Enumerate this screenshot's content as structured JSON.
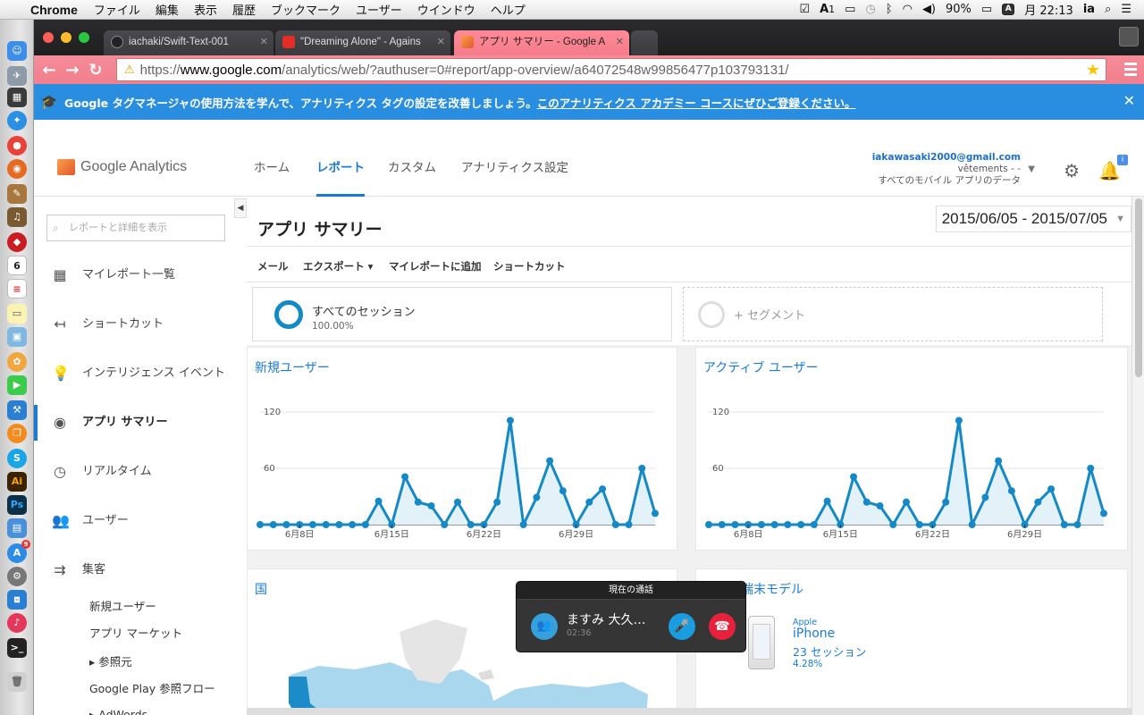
{
  "menubar": {
    "app": "Chrome",
    "items": [
      "ファイル",
      "編集",
      "表示",
      "履歴",
      "ブックマーク",
      "ユーザー",
      "ウインドウ",
      "ヘルプ"
    ],
    "badge_a1": "1",
    "battery": "90%",
    "clock": "月 22:13",
    "user": "ia",
    "a_box": "A"
  },
  "dock": {
    "calendar_day": "6",
    "badge_count": "9"
  },
  "browser": {
    "tabs": [
      {
        "title": "iachaki/Swift-Text-001"
      },
      {
        "title": "\"Dreaming Alone\" - Agains"
      },
      {
        "title": "アプリ サマリー - Google A"
      }
    ],
    "url_prefix": "https://",
    "url_host": "www.google.com",
    "url_path": "/analytics/web/?authuser=0#report/app-overview/a64072548w99856477p103793131/"
  },
  "notice": {
    "text": "Google タグマネージャの使用方法を学んで、アナリティクス タグの設定を改善しましょう。",
    "link": "このアナリティクス アカデミー コースにぜひご登録ください。"
  },
  "header": {
    "logo": "Google Analytics",
    "tabs": [
      "ホーム",
      "レポート",
      "カスタム",
      "アナリティクス設定"
    ],
    "email": "iakawasaki2000@gmail.com",
    "property": "vêtements - -",
    "view": "すべてのモバイル アプリのデータ",
    "bell_badge": "i"
  },
  "leftnav": {
    "search_placeholder": "レポートと詳細を表示",
    "items": [
      "マイレポート一覧",
      "ショートカット",
      "インテリジェンス イベント",
      "アプリ サマリー",
      "リアルタイム",
      "ユーザー",
      "集客"
    ],
    "sub_items": [
      "新規ユーザー",
      "アプリ マーケット",
      "▸ 参照元",
      "Google Play 参照フロー",
      "▸ AdWords"
    ]
  },
  "main": {
    "title": "アプリ サマリー",
    "date_range": "2015/06/05 - 2015/07/05",
    "actions": [
      "メール",
      "エクスポート ▾",
      "マイレポートに追加",
      "ショートカット"
    ],
    "segment_name": "すべてのセッション",
    "segment_pct": "100.00%",
    "add_segment": "+ セグメント",
    "country_title": "国",
    "device_title": "上位の端末モデル",
    "device": {
      "brand": "Apple",
      "model": "iPhone",
      "sessions": "23 セッション",
      "pct": "4.28%"
    }
  },
  "call": {
    "header": "現在の通話",
    "name": "ますみ 大久…",
    "time": "02:36"
  },
  "colors": {
    "accent": "#1a7bd6",
    "chart_line": "#1589c6",
    "chart_fill": "#e3f1f9",
    "tab_active": "#f58c99",
    "notice": "#2a8ee0"
  },
  "chart_data": [
    {
      "type": "area",
      "title": "新規ユーザー",
      "ylim": [
        0,
        120
      ],
      "yticks": [
        "120",
        "60"
      ],
      "xtick_labels": [
        "6月8日",
        "6月15日",
        "6月22日",
        "6月29日"
      ],
      "x": [
        "6/5",
        "6/6",
        "6/7",
        "6/8",
        "6/9",
        "6/10",
        "6/11",
        "6/12",
        "6/13",
        "6/14",
        "6/15",
        "6/16",
        "6/17",
        "6/18",
        "6/19",
        "6/20",
        "6/21",
        "6/22",
        "6/23",
        "6/24",
        "6/25",
        "6/26",
        "6/27",
        "6/28",
        "6/29",
        "6/30",
        "7/1",
        "7/2",
        "7/3",
        "7/4",
        "7/5"
      ],
      "values": [
        0,
        0,
        0,
        0,
        0,
        0,
        0,
        0,
        0,
        25,
        0,
        51,
        24,
        20,
        0,
        24,
        0,
        0,
        24,
        111,
        0,
        29,
        68,
        36,
        0,
        24,
        38,
        0,
        0,
        60,
        12
      ]
    },
    {
      "type": "area",
      "title": "アクティブ ユーザー",
      "ylim": [
        0,
        120
      ],
      "yticks": [
        "120",
        "60"
      ],
      "xtick_labels": [
        "6月8日",
        "6月15日",
        "6月22日",
        "6月29日"
      ],
      "x": [
        "6/5",
        "6/6",
        "6/7",
        "6/8",
        "6/9",
        "6/10",
        "6/11",
        "6/12",
        "6/13",
        "6/14",
        "6/15",
        "6/16",
        "6/17",
        "6/18",
        "6/19",
        "6/20",
        "6/21",
        "6/22",
        "6/23",
        "6/24",
        "6/25",
        "6/26",
        "6/27",
        "6/28",
        "6/29",
        "6/30",
        "7/1",
        "7/2",
        "7/3",
        "7/4",
        "7/5"
      ],
      "values": [
        0,
        0,
        0,
        0,
        0,
        0,
        0,
        0,
        0,
        25,
        0,
        51,
        24,
        20,
        0,
        24,
        0,
        0,
        24,
        111,
        0,
        29,
        68,
        36,
        0,
        24,
        38,
        0,
        0,
        60,
        12
      ]
    }
  ]
}
